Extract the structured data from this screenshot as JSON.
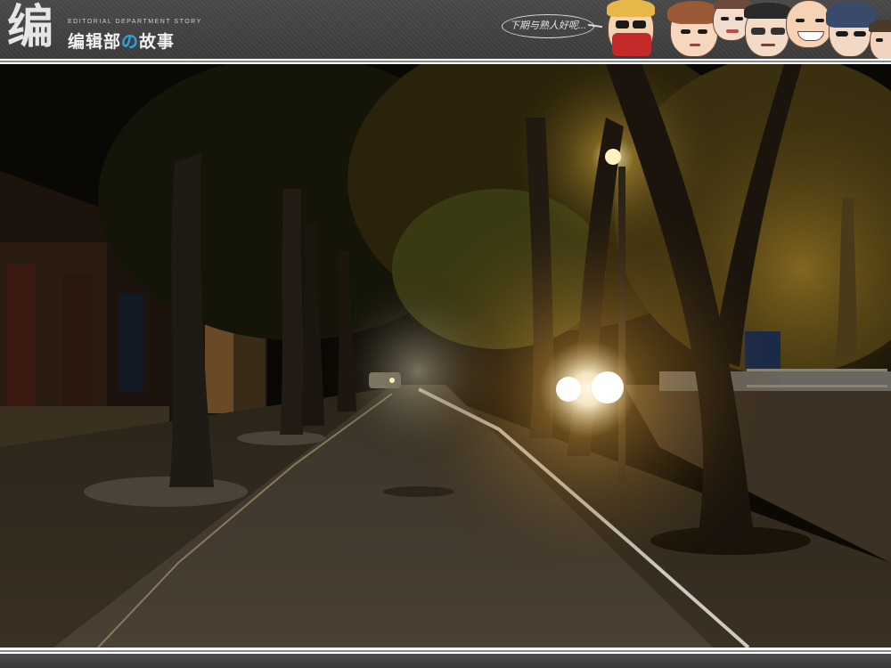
{
  "header": {
    "logo_mark": "编",
    "subtitle": "EDITORIAL DEPARTMENT STORY",
    "title_part1": "编辑部",
    "title_accent": "の",
    "title_part2": "故事",
    "speech_bubble": "下期与熟人好呢..."
  },
  "colors": {
    "banner": "#434343",
    "accent": "#2aa6e6",
    "separator": "#8a8a8a",
    "streetlight": "#fff6e0",
    "foliage": "#5a4a14"
  },
  "photo": {
    "subject": "night-street-scene",
    "icon": "photo"
  }
}
